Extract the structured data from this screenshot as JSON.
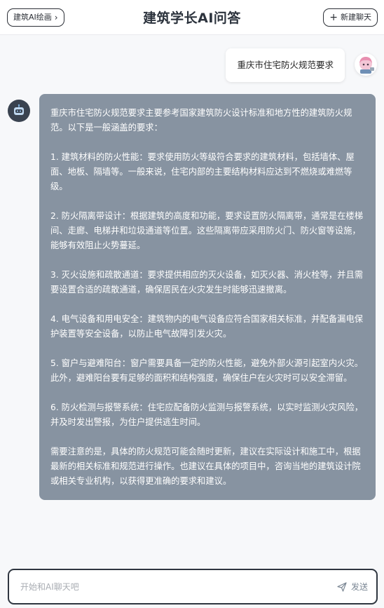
{
  "header": {
    "left_button": "建筑AI绘画",
    "title": "建筑学长AI问答",
    "right_button": "新建聊天"
  },
  "conversation": {
    "user_message": "重庆市住宅防火规范要求",
    "bot_paragraphs": [
      "重庆市住宅防火规范要求主要参考国家建筑防火设计标准和地方性的建筑防火规范。以下是一般涵盖的要求：",
      "1. 建筑材料的防火性能：要求使用防火等级符合要求的建筑材料，包括墙体、屋面、地板、隔墙等。一般来说，住宅内部的主要结构材料应达到不燃烧或难燃等级。",
      "2. 防火隔离带设计：根据建筑的高度和功能，要求设置防火隔离带，通常是在楼梯间、走廊、电梯井和垃圾通道等位置。这些隔离带应采用防火门、防火窗等设施，能够有效阻止火势蔓延。",
      "3. 灭火设施和疏散通道：要求提供相应的灭火设备，如灭火器、消火栓等，并且需要设置合适的疏散通道，确保居民在火灾发生时能够迅速撤离。",
      "4. 电气设备和用电安全：建筑物内的电气设备应符合国家相关标准，并配备漏电保护装置等安全设备，以防止电气故障引发火灾。",
      "5. 窗户与避难阳台：窗户需要具备一定的防火性能，避免外部火源引起室内火灾。此外，避难阳台要有足够的面积和结构强度，确保住户在火灾时可以安全滞留。",
      "6. 防火检测与报警系统：住宅应配备防火监测与报警系统，以实时监测火灾风险，并及时发出警报，为住户提供逃生时间。",
      "需要注意的是，具体的防火规范可能会随时更新，建议在实际设计和施工中，根据最新的相关标准和规范进行操作。也建议在具体的项目中，咨询当地的建筑设计院或相关专业机构，以获得更准确的要求和建议。"
    ]
  },
  "input": {
    "placeholder": "开始和AI聊天吧",
    "send_label": "发送"
  },
  "icons": {
    "chevron": "chevron-right-icon",
    "plus": "plus-icon",
    "send": "paper-plane-icon",
    "bot": "robot-icon",
    "user": "user-avatar-icon"
  },
  "colors": {
    "bot_bubble": "#8793a1",
    "header_bg": "#ffffff",
    "page_bg": "#f7f8fa",
    "input_border": "#2f3640"
  }
}
